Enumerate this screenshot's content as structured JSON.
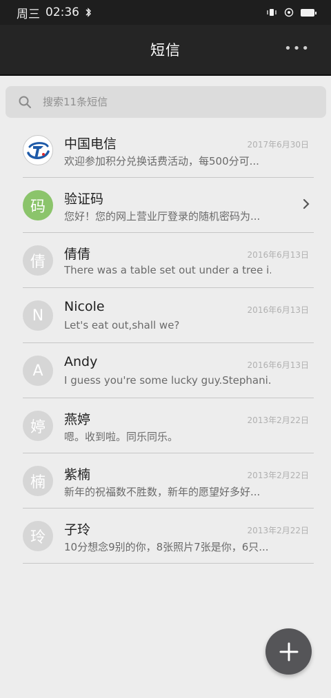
{
  "status_bar": {
    "day": "周三",
    "time": "02:36"
  },
  "header": {
    "title": "短信",
    "more_label": "•••"
  },
  "search": {
    "placeholder": "搜索11条短信"
  },
  "conversations": [
    {
      "name": "中国电信",
      "date": "2017年6月30日",
      "preview": "欢迎参加积分兑换话费活动，每500分可...",
      "avatar_type": "logo",
      "avatar_text": ""
    },
    {
      "name": "验证码",
      "date": "",
      "preview": "您好！您的网上营业厅登录的随机密码为...",
      "avatar_type": "green",
      "avatar_text": "码"
    },
    {
      "name": "倩倩",
      "date": "2016年6月13日",
      "preview": "There was a table set out under a tree i...",
      "avatar_type": "grey",
      "avatar_text": "倩"
    },
    {
      "name": "Nicole",
      "date": "2016年6月13日",
      "preview": "Let's eat out,shall we?",
      "avatar_type": "grey",
      "avatar_text": "N"
    },
    {
      "name": "Andy",
      "date": "2016年6月13日",
      "preview": "I guess you're some lucky guy.Stephani...",
      "avatar_type": "grey",
      "avatar_text": "A"
    },
    {
      "name": "燕婷",
      "date": "2013年2月22日",
      "preview": "嗯。收到啦。同乐同乐。",
      "avatar_type": "grey",
      "avatar_text": "婷"
    },
    {
      "name": "紫楠",
      "date": "2013年2月22日",
      "preview": "新年的祝福数不胜数，新年的愿望好多好...",
      "avatar_type": "grey",
      "avatar_text": "楠"
    },
    {
      "name": "子玲",
      "date": "2013年2月22日",
      "preview": "10分想念9别的你，8张照片7张是你，6只...",
      "avatar_type": "grey",
      "avatar_text": "玲"
    }
  ],
  "colors": {
    "header_bg": "#252525",
    "accent_green": "#8bc46b",
    "fab_bg": "#555558"
  },
  "icons": {
    "bluetooth": "bluetooth-icon",
    "vibrate": "vibrate-icon",
    "alarm": "alarm-icon",
    "battery": "battery-icon",
    "search": "search-icon",
    "chevron": "chevron-right-icon",
    "add": "plus-icon"
  }
}
